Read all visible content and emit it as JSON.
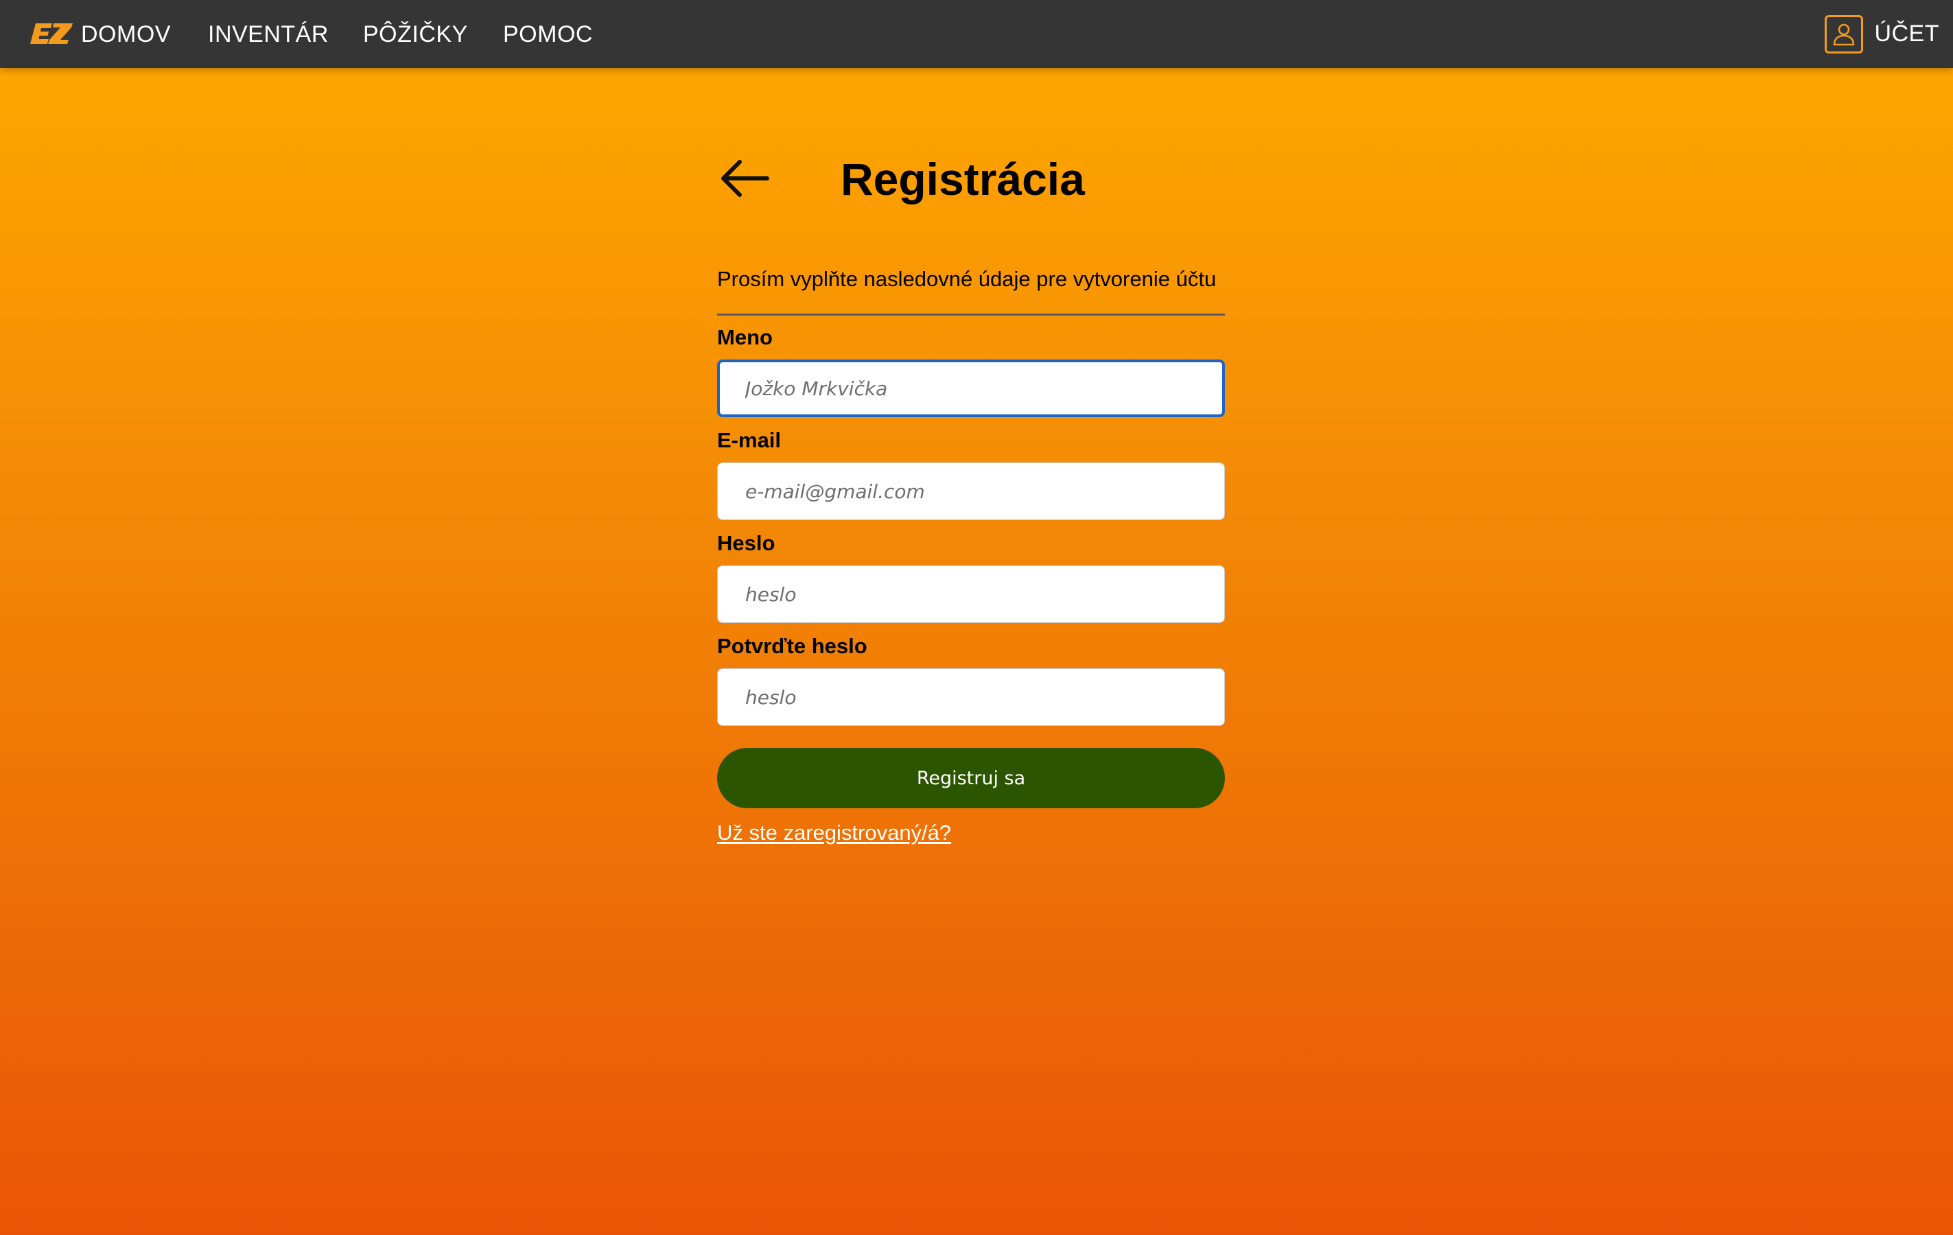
{
  "navbar": {
    "logo_text": "EZ",
    "links": {
      "domov": "DOMOV",
      "inventar": "INVENTÁR",
      "pozicky": "PÔŽIČKY",
      "pomoc": "POMOC"
    },
    "account_label": "ÚČET"
  },
  "page": {
    "title": "Registrácia",
    "subtitle": "Prosím vyplňte nasledovné údaje pre vytvorenie účtu"
  },
  "form": {
    "name": {
      "label": "Meno",
      "placeholder": "Jožko Mrkvička",
      "value": ""
    },
    "email": {
      "label": "E-mail",
      "placeholder": "e-mail@gmail.com",
      "value": ""
    },
    "password": {
      "label": "Heslo",
      "placeholder": "heslo",
      "value": ""
    },
    "password_confirm": {
      "label": "Potvrďte heslo",
      "placeholder": "heslo",
      "value": ""
    },
    "submit_label": "Registruj sa",
    "login_link": "Už ste zaregistrovaný/á?"
  },
  "colors": {
    "navbar_bg": "#353535",
    "accent_orange": "#f39a1f",
    "submit_green": "#2c5502",
    "focus_blue": "#1d64c9",
    "gradient_top": "#ffa600",
    "gradient_bottom": "#e95506"
  },
  "icons": {
    "logo": "ez-logo",
    "account": "user-icon",
    "back": "arrow-left-icon"
  }
}
